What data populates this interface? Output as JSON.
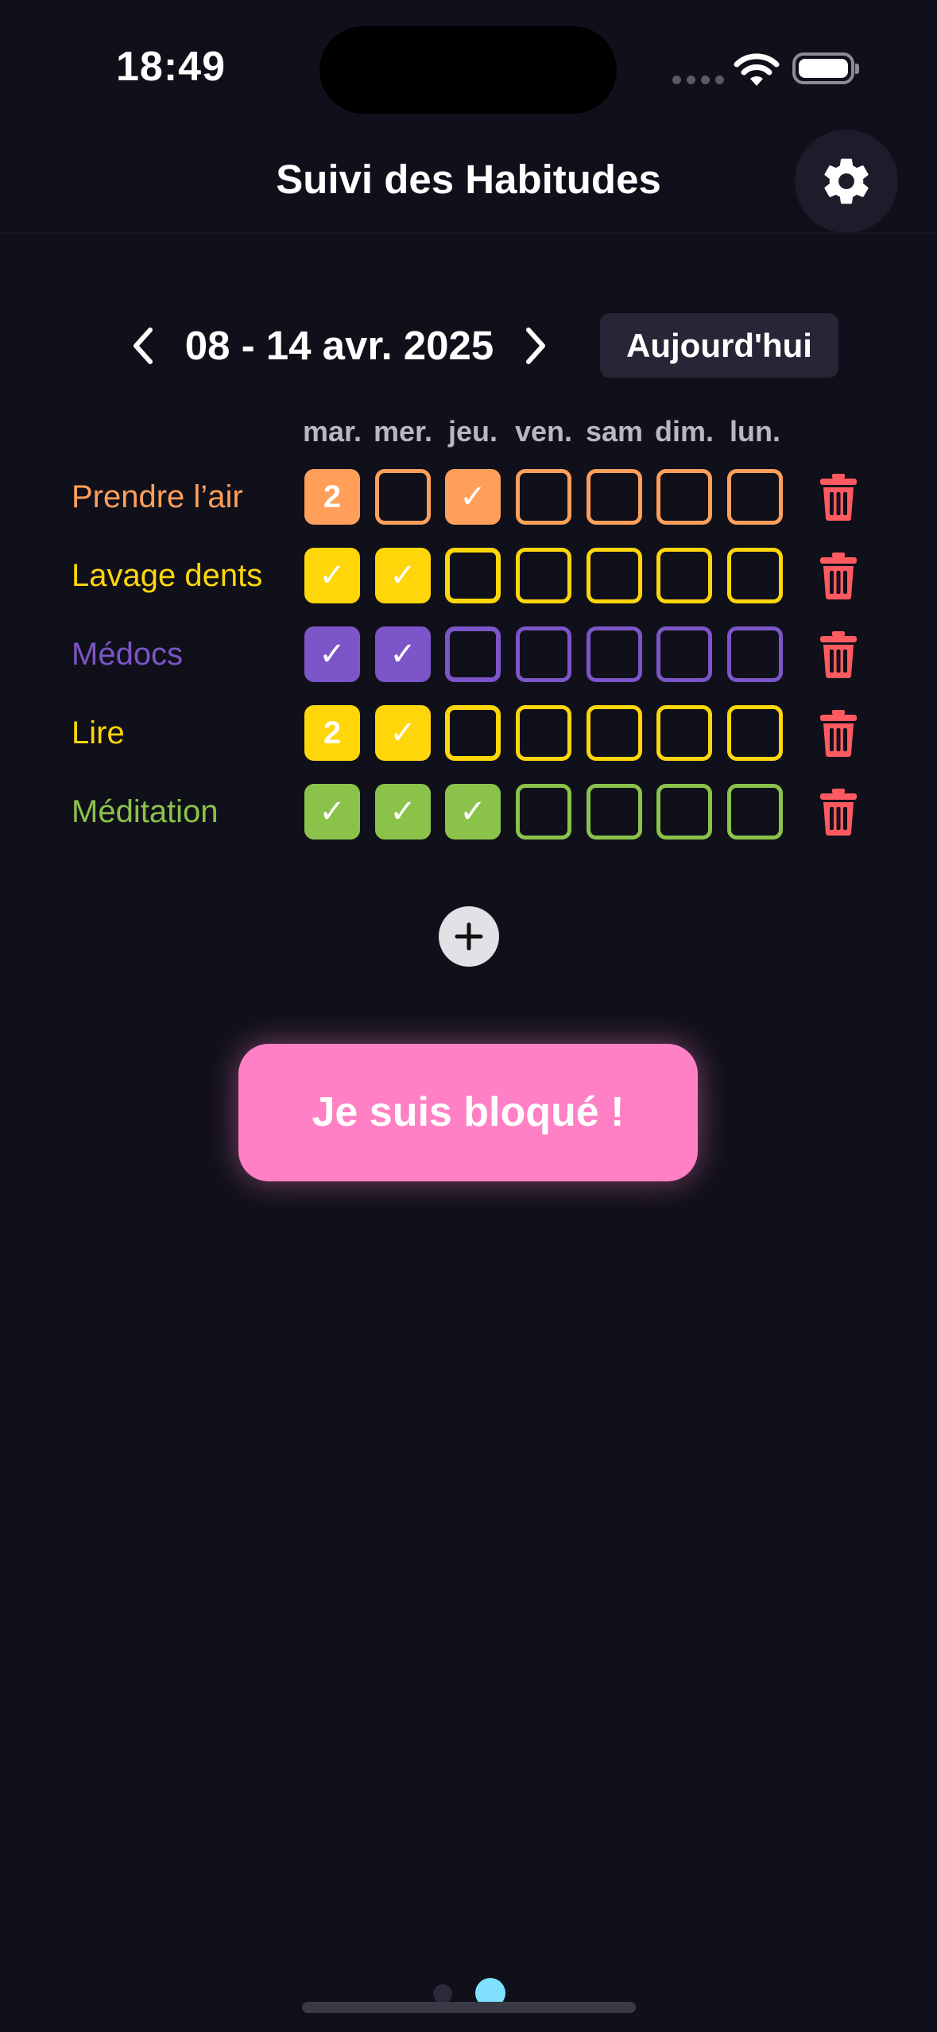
{
  "status_bar": {
    "time": "18:49"
  },
  "header": {
    "title": "Suivi des Habitudes"
  },
  "week_nav": {
    "range": "08 - 14 avr. 2025",
    "today_label": "Aujourd'hui"
  },
  "days": [
    "mar.",
    "mer.",
    "jeu.",
    "ven.",
    "sam",
    "dim.",
    "lun."
  ],
  "colors": {
    "delete": "#ff5a5f",
    "accent_pink": "#ff80c4"
  },
  "habits": [
    {
      "name": "Prendre l’air",
      "color": "#ff9f5a",
      "cells": [
        "2",
        "",
        "✓",
        "",
        "",
        "",
        ""
      ]
    },
    {
      "name": "Lavage dents",
      "color": "#ffd60a",
      "cells": [
        "✓",
        "✓",
        "",
        "",
        "",
        "",
        ""
      ]
    },
    {
      "name": "Médocs",
      "color": "#7c55c8",
      "cells": [
        "✓",
        "✓",
        "",
        "",
        "",
        "",
        ""
      ]
    },
    {
      "name": "Lire",
      "color": "#ffd60a",
      "cells": [
        "2",
        "✓",
        "",
        "",
        "",
        "",
        ""
      ]
    },
    {
      "name": "Méditation",
      "color": "#8bc34a",
      "cells": [
        "✓",
        "✓",
        "✓",
        "",
        "",
        "",
        ""
      ]
    }
  ],
  "actions": {
    "stuck_label": "Je suis bloqué !"
  }
}
